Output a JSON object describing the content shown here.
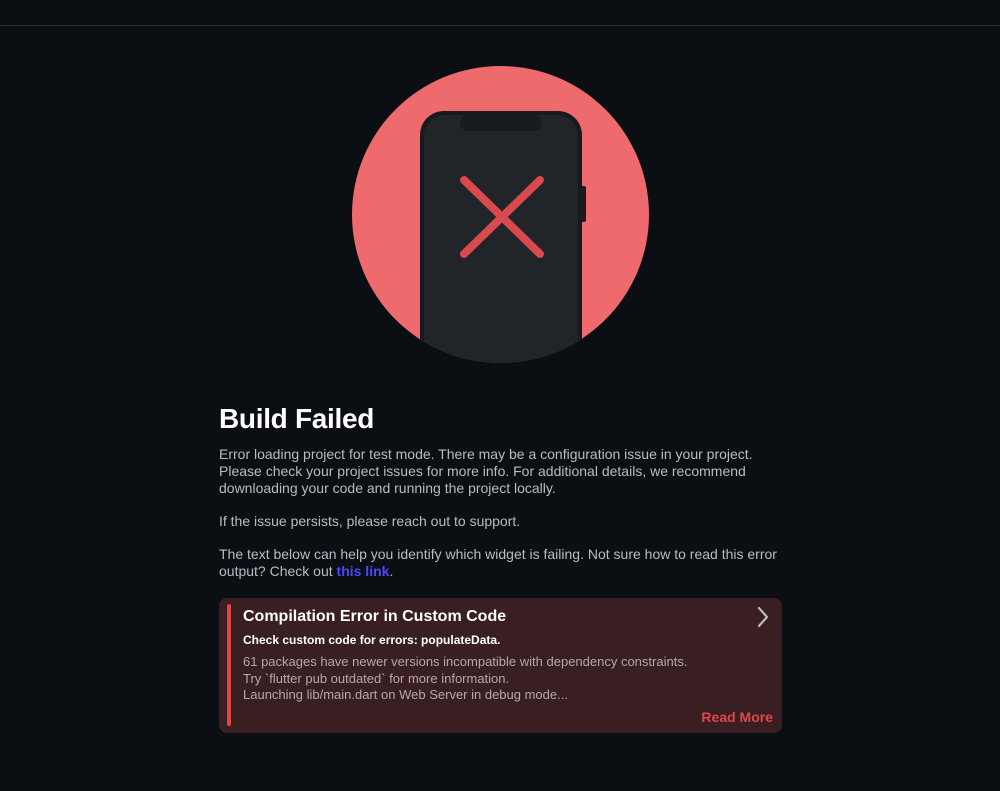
{
  "page": {
    "title": "Build Failed",
    "paragraph1": "Error loading project for test mode. There may be a configuration issue in your project. Please check your project issues for more info. For additional details, we recommend downloading your code and running the project locally.",
    "paragraph2": "If the issue persists, please reach out to support.",
    "paragraph3_text": "The text below can help you identify which widget is failing. Not sure how to read this error output? Check out ",
    "paragraph3_link": "this link",
    "paragraph3_end": "."
  },
  "error": {
    "title": "Compilation Error in Custom Code",
    "subtitle": "Check custom code for errors: populateData.",
    "log": [
      "61 packages have newer versions incompatible with dependency constraints.",
      "Try `flutter pub outdated` for more information.",
      "Launching lib/main.dart on Web Server in debug mode..."
    ],
    "read_more": "Read More"
  },
  "colors": {
    "background": "#0b0e12",
    "illustration_circle": "#ee6a6d",
    "phone_body": "#212529",
    "error_accent": "#e0454a",
    "link": "#4b47ff",
    "card_background": "#3a1f22"
  },
  "icons": {
    "illustration": "phone-with-x-icon",
    "expand": "chevron-right-icon"
  }
}
